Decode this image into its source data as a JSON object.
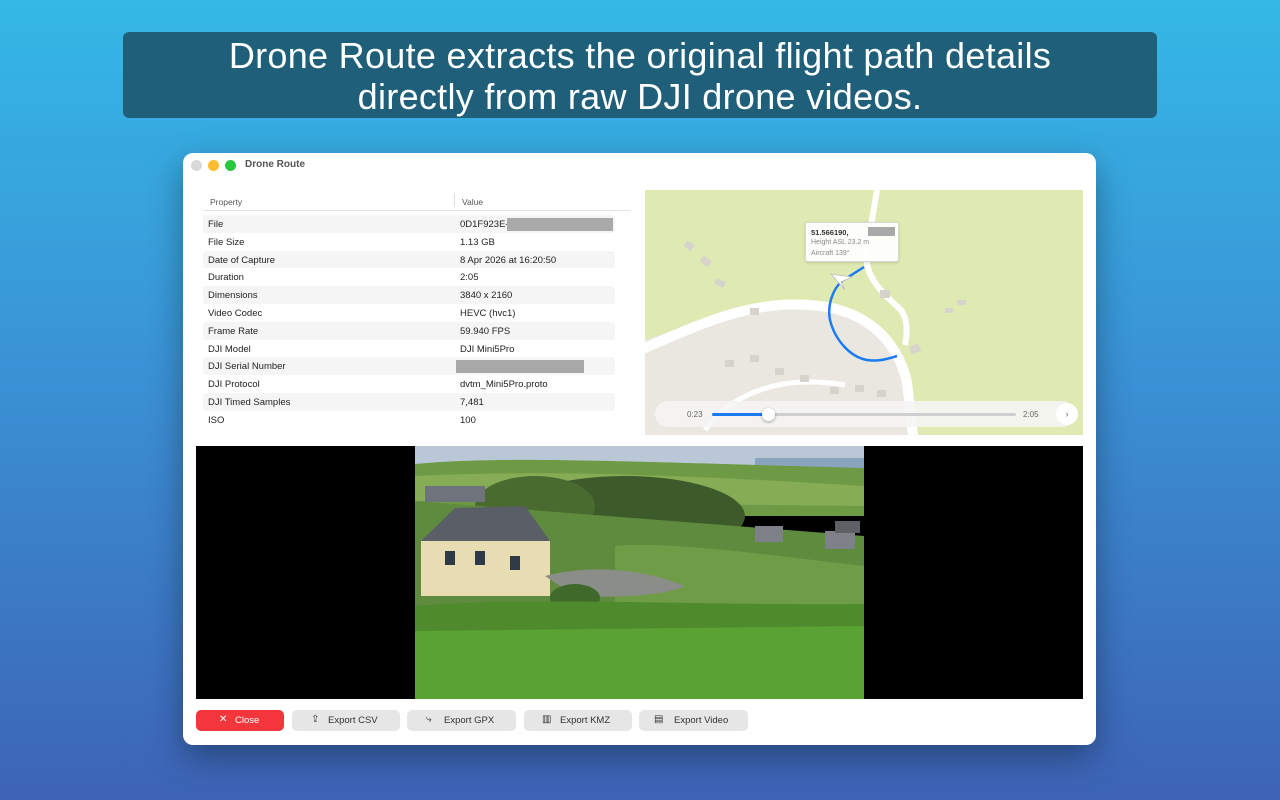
{
  "banner": {
    "line1": "Drone Route extracts the original flight path details",
    "line2": "directly from raw DJI drone videos."
  },
  "window": {
    "title": "Drone Route"
  },
  "table": {
    "col_property": "Property",
    "col_value": "Value",
    "rows": [
      {
        "k": "File",
        "v": "0D1F923E-"
      },
      {
        "k": "File Size",
        "v": "1.13 GB"
      },
      {
        "k": "Date of Capture",
        "v": "8 Apr 2026 at 16:20:50"
      },
      {
        "k": "Duration",
        "v": "2:05"
      },
      {
        "k": "Dimensions",
        "v": "3840 x 2160"
      },
      {
        "k": "Video Codec",
        "v": "HEVC (hvc1)"
      },
      {
        "k": "Frame Rate",
        "v": "59.940 FPS"
      },
      {
        "k": "DJI Model",
        "v": "DJI Mini5Pro"
      },
      {
        "k": "DJI Serial Number",
        "v": ""
      },
      {
        "k": "DJI Protocol",
        "v": "dvtm_Mini5Pro.proto"
      },
      {
        "k": "DJI Timed Samples",
        "v": "7,481"
      },
      {
        "k": "ISO",
        "v": "100"
      }
    ]
  },
  "map": {
    "pin": {
      "coord": "51.566190,",
      "height": "Height ASL 23.2 m",
      "aircraft": "Aircraft 139°"
    },
    "player": {
      "current_time": "0:23",
      "total_time": "2:05",
      "progress": 0.184
    },
    "route_color": "#1a7bf2"
  },
  "buttons": {
    "close": "Close",
    "export_csv": "Export CSV",
    "export_gpx": "Export GPX",
    "export_kmz": "Export KMZ",
    "export_video": "Export Video"
  },
  "colors": {
    "accent": "#1a7bf2",
    "close": "#f2363c"
  }
}
